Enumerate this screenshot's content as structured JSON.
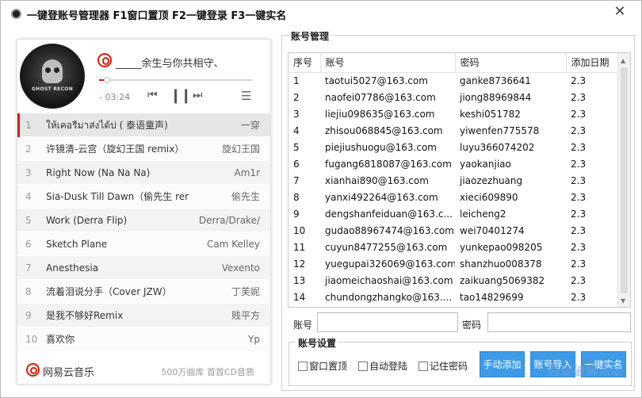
{
  "window": {
    "title": "一键登账号管理器 F1窗口置顶 F2一键登录 F3一键实名",
    "close_glyph": "✕"
  },
  "player": {
    "album_label": "GHOST RECON",
    "song_title": "_____余生与你共相守、",
    "progress_fraction": 0.04,
    "time": "- 03:24",
    "icons": {
      "prev": "prev-track-icon",
      "pause": "pause-icon",
      "next": "next-track-icon",
      "list": "playlist-icon",
      "brand": "netease-music-icon"
    },
    "playlist": [
      {
        "num": "1",
        "name": "ให้เคอรีมาส่งได้บ่ ( 泰语童声)",
        "artist": "一穿",
        "active": true
      },
      {
        "num": "2",
        "name": "许镜清-云宫（旋幻王国 remix）",
        "artist": "旋幻王国"
      },
      {
        "num": "3",
        "name": "Right Now (Na Na Na)",
        "artist": "Am1r"
      },
      {
        "num": "4",
        "name": "Sia-Dusk Till Dawn（偷先生 rer",
        "artist": "偷先生"
      },
      {
        "num": "5",
        "name": "Work (Derra Flip)",
        "artist": "Derra/Drake/"
      },
      {
        "num": "6",
        "name": "Sketch Plane",
        "artist": "Cam Kelley"
      },
      {
        "num": "7",
        "name": "Anesthesia",
        "artist": "Vexento"
      },
      {
        "num": "8",
        "name": "流着泪说分手（Cover JZW）",
        "artist": "丁芙妮"
      },
      {
        "num": "9",
        "name": "是我不够好Remix",
        "artist": "贱平方"
      },
      {
        "num": "10",
        "name": "喜欢你",
        "artist": "Yp"
      }
    ],
    "footer": {
      "brand": "网易云音乐",
      "slogan": "500万曲库 首首CD音质"
    }
  },
  "accounts": {
    "group_title": "账号管理",
    "columns": [
      "序号",
      "账号",
      "密码",
      "添加日期"
    ],
    "rows": [
      [
        "1",
        "taotui5027@163.com",
        "ganke8736641",
        "2.3"
      ],
      [
        "2",
        "naofei07786@163.com",
        "jiong88969844",
        "2.3"
      ],
      [
        "3",
        "liejiu098635@163.com",
        "keshi051782",
        "2.3"
      ],
      [
        "4",
        "zhisou068845@163.com",
        "yiwenfen775578",
        "2.3"
      ],
      [
        "5",
        "piejiushuogu@163.com",
        "luyu366074202",
        "2.3"
      ],
      [
        "6",
        "fugang6818087@163.com",
        "yaokanjiao",
        "2.3"
      ],
      [
        "7",
        "xianhai890@163.com",
        "jiaozezhuang",
        "2.3"
      ],
      [
        "8",
        "yanxi492264@163.com",
        "xieci609890",
        "2.3"
      ],
      [
        "9",
        "dengshanfeiduan@163.c...",
        "leicheng2",
        "2.3"
      ],
      [
        "10",
        "gudao88967474@163.com",
        "wei70401274",
        "2.3"
      ],
      [
        "11",
        "cuyun8477255@163.com",
        "yunkepao098205",
        "2.3"
      ],
      [
        "12",
        "yuegupai326069@163.com",
        "shanzhuo008378",
        "2.3"
      ],
      [
        "13",
        "jiaomeichaoshai@163.com",
        "zaikuang5069382",
        "2.3"
      ],
      [
        "14",
        "chundongzhangko@163....",
        "tao14829699",
        "2.3"
      ]
    ],
    "account_label": "账号",
    "account_value": "",
    "password_label": "密码",
    "password_value": ""
  },
  "settings": {
    "group_title": "账号设置",
    "checkboxes": [
      {
        "label": "窗口置顶",
        "checked": false
      },
      {
        "label": "自动登陆",
        "checked": false
      },
      {
        "label": "记住密码",
        "checked": false
      }
    ],
    "buttons": [
      "手动添加",
      "账号导入",
      "一键实名"
    ]
  },
  "watermark": "吾爱破解论坛",
  "colors": {
    "accent_red": "#d81e06",
    "button_blue": "#3d9ae8"
  }
}
